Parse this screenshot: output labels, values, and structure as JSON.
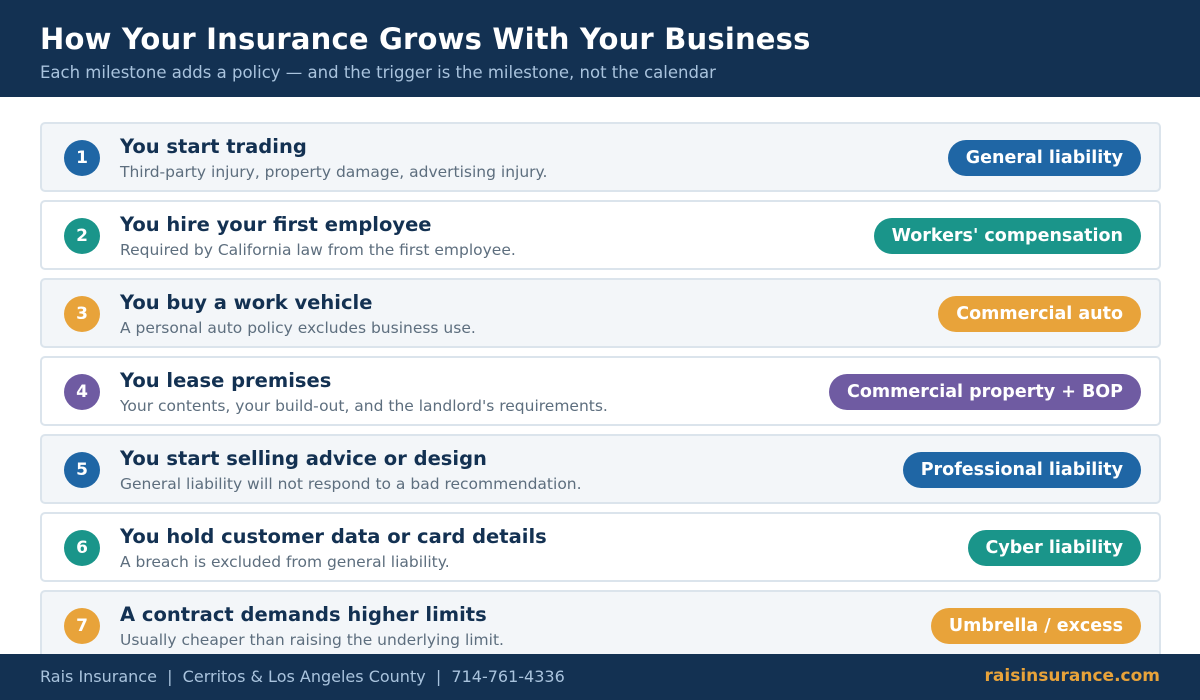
{
  "header": {
    "title": "How Your Insurance Grows With Your Business",
    "subtitle": "Each milestone adds a policy — and the trigger is the milestone, not the calendar"
  },
  "colors": {
    "navy": "#133152",
    "blue": "#1f66a5",
    "teal": "#1a958a",
    "orange": "#e8a33a",
    "purple": "#6f5ba2"
  },
  "milestones": [
    {
      "number": "1",
      "title": "You start trading",
      "description": "Third-party injury, property damage, advertising injury.",
      "policy": "General liability",
      "color": "#1f66a5"
    },
    {
      "number": "2",
      "title": "You hire your first employee",
      "description": "Required by California law from the first employee.",
      "policy": "Workers' compensation",
      "color": "#1a958a"
    },
    {
      "number": "3",
      "title": "You buy a work vehicle",
      "description": "A personal auto policy excludes business use.",
      "policy": "Commercial auto",
      "color": "#e8a33a"
    },
    {
      "number": "4",
      "title": "You lease premises",
      "description": "Your contents, your build-out, and the landlord's requirements.",
      "policy": "Commercial property + BOP",
      "color": "#6f5ba2"
    },
    {
      "number": "5",
      "title": "You start selling advice or design",
      "description": "General liability will not respond to a bad recommendation.",
      "policy": "Professional liability",
      "color": "#1f66a5"
    },
    {
      "number": "6",
      "title": "You hold customer data or card details",
      "description": "A breach is excluded from general liability.",
      "policy": "Cyber liability",
      "color": "#1a958a"
    },
    {
      "number": "7",
      "title": "A contract demands higher limits",
      "description": "Usually cheaper than raising the underlying limit.",
      "policy": "Umbrella / excess",
      "color": "#e8a33a"
    }
  ],
  "footer": {
    "contact": "Rais Insurance  |  Cerritos & Los Angeles County  |  714-761-4336",
    "website": "raisinsurance.com"
  }
}
